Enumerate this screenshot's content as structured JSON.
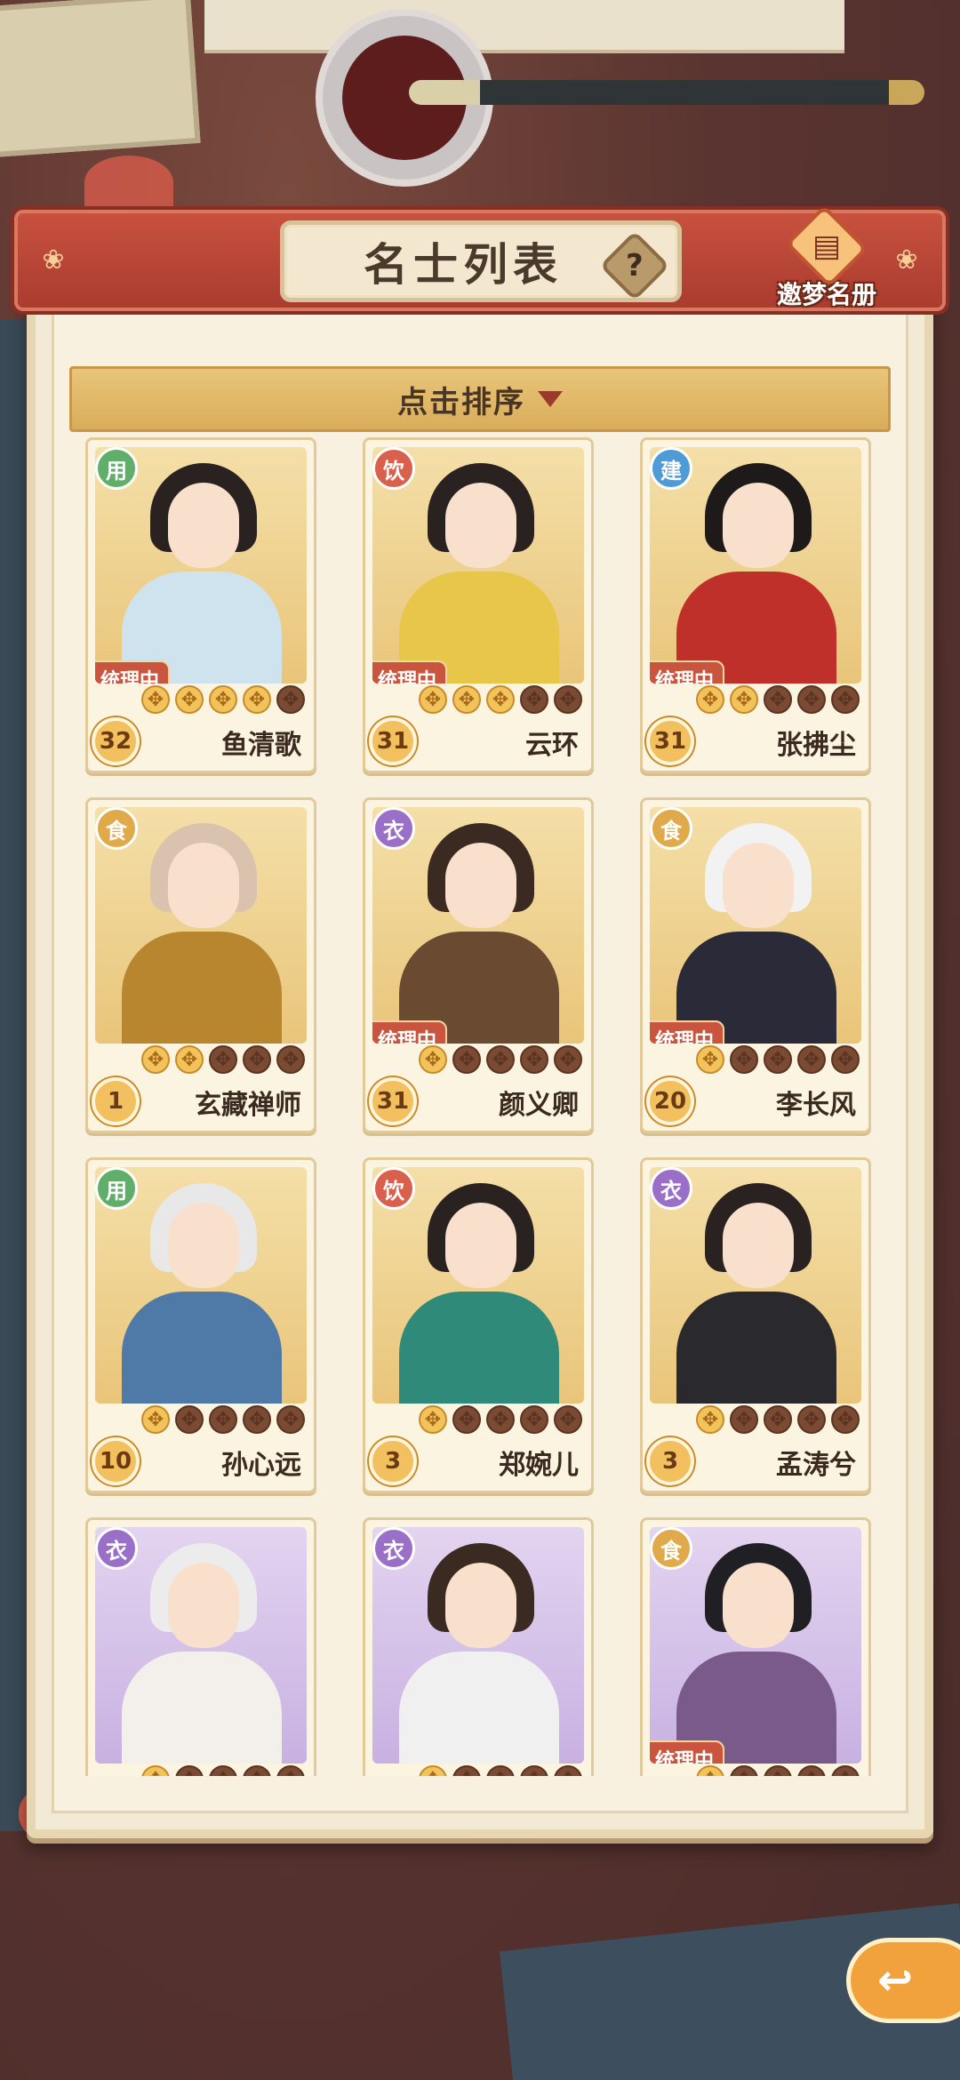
{
  "header": {
    "title": "名士列表",
    "help_icon": "question-icon",
    "help_glyph": "?",
    "dream_label": "邀梦名册",
    "dream_icon": "book-icon",
    "ornament_glyph": "❀"
  },
  "sort": {
    "label": "点击排序"
  },
  "manage_tag_text": "统理中",
  "colors": {
    "header_red": "#c9523f",
    "panel_cream": "#f8f1e0",
    "sort_gold": "#e8c57a",
    "manage_tag": "#c9553e"
  },
  "cards": [
    {
      "badge": "用",
      "badge_color": "green",
      "bg": "gold",
      "managing": true,
      "stars_on": 4,
      "level": "32",
      "name": "鱼清歌",
      "hair": "#2a2220",
      "robe": "#cfe3ef"
    },
    {
      "badge": "饮",
      "badge_color": "red",
      "bg": "gold",
      "managing": true,
      "stars_on": 3,
      "level": "31",
      "name": "云环",
      "hair": "#2a2220",
      "robe": "#e7c64a"
    },
    {
      "badge": "建",
      "badge_color": "blue",
      "bg": "gold",
      "managing": true,
      "stars_on": 2,
      "level": "31",
      "name": "张拂尘",
      "hair": "#1f1a1a",
      "robe": "#c0302a"
    },
    {
      "badge": "食",
      "badge_color": "gold",
      "bg": "gold",
      "managing": false,
      "stars_on": 2,
      "level": "1",
      "name": "玄藏禅师",
      "hair": "#d9c3ae",
      "robe": "#b8862f"
    },
    {
      "badge": "衣",
      "badge_color": "purple",
      "bg": "gold",
      "managing": true,
      "stars_on": 1,
      "level": "31",
      "name": "颜义卿",
      "hair": "#3a2a22",
      "robe": "#6a4a30"
    },
    {
      "badge": "食",
      "badge_color": "gold",
      "bg": "gold",
      "managing": true,
      "stars_on": 1,
      "level": "20",
      "name": "李长风",
      "hair": "#f2f2f2",
      "robe": "#2a2a38"
    },
    {
      "badge": "用",
      "badge_color": "green",
      "bg": "gold",
      "managing": false,
      "stars_on": 1,
      "level": "10",
      "name": "孙心远",
      "hair": "#e8e8e8",
      "robe": "#4f7aa8"
    },
    {
      "badge": "饮",
      "badge_color": "red",
      "bg": "gold",
      "managing": false,
      "stars_on": 1,
      "level": "3",
      "name": "郑婉儿",
      "hair": "#2a2220",
      "robe": "#2f8a7a"
    },
    {
      "badge": "衣",
      "badge_color": "purple",
      "bg": "gold",
      "managing": false,
      "stars_on": 1,
      "level": "3",
      "name": "孟涛兮",
      "hair": "#2a2220",
      "robe": "#2a2a2e"
    },
    {
      "badge": "衣",
      "badge_color": "purple",
      "bg": "purple",
      "managing": false,
      "stars_on": 1,
      "level": "",
      "name": "",
      "hair": "#ececec",
      "robe": "#f3f0ec"
    },
    {
      "badge": "衣",
      "badge_color": "purple",
      "bg": "purple",
      "managing": false,
      "stars_on": 1,
      "level": "",
      "name": "",
      "hair": "#3a2a22",
      "robe": "#f0f0f0"
    },
    {
      "badge": "食",
      "badge_color": "gold",
      "bg": "purple",
      "managing": true,
      "stars_on": 1,
      "level": "",
      "name": "",
      "hair": "#1f1f24",
      "robe": "#7a5a8a"
    }
  ],
  "back_button": {
    "icon": "back-arrow-icon",
    "glyph": "↩"
  }
}
